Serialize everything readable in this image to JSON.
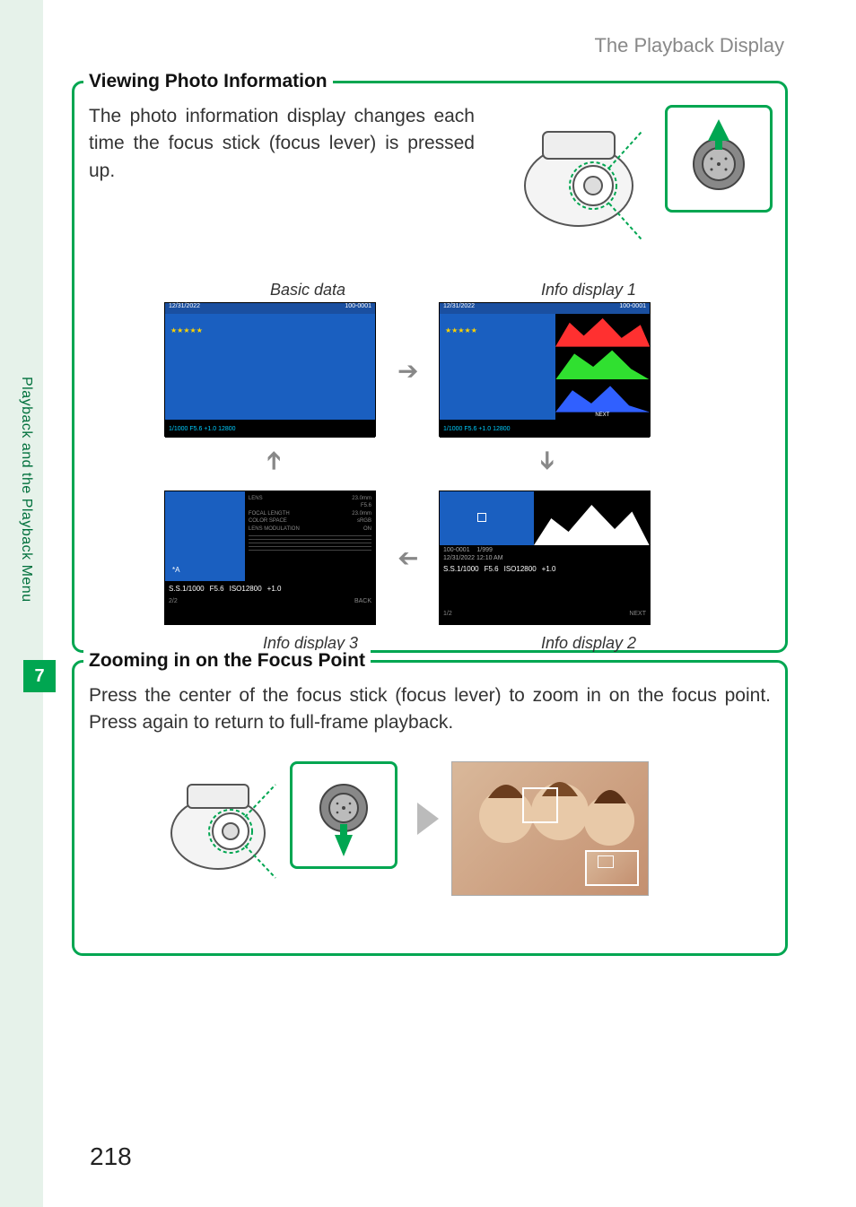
{
  "header": {
    "title": "The Playback Display"
  },
  "sidebar": {
    "text": "Playback and the Playback Menu",
    "chapter": "7"
  },
  "box1": {
    "title": "Viewing Photo Information",
    "body": "The photo information display changes each time the focus stick (focus lever) is pressed up.",
    "labels": {
      "basic": "Basic data",
      "info1": "Info display 1",
      "info2": "Info display 2",
      "info3": "Info display 3"
    },
    "screen": {
      "date": "12/31/2022",
      "frame": "1/999",
      "card": "100-0001",
      "bottom": "1/1000   F5.6  +1.0  12800",
      "next": "NEXT",
      "back": "BACK",
      "ss": "S.S.1/1000",
      "f": "F5.6",
      "iso": "ISO12800",
      "ev": "+1.0",
      "time": "12/31/2022 12:10 AM",
      "page12": "1/2",
      "page22": "2/2"
    }
  },
  "box2": {
    "title": "Zooming in on the Focus Point",
    "body": "Press the center of the focus stick (focus lever) to zoom in on the focus point.  Press again to return to full-frame playback."
  },
  "page_number": "218"
}
